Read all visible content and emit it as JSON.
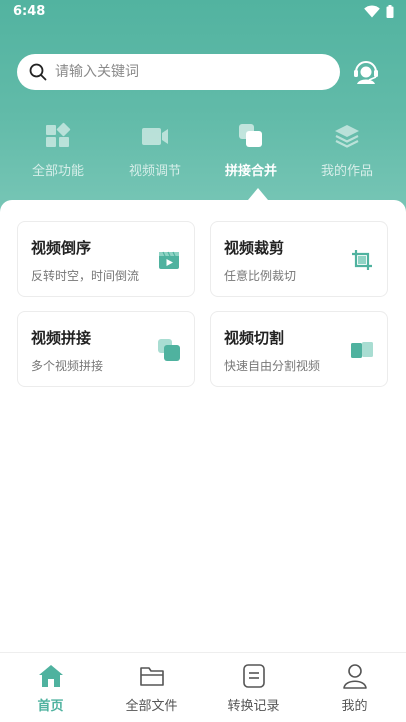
{
  "status_bar": {
    "time": "6:48"
  },
  "search": {
    "placeholder": "请输入关键词"
  },
  "categories": [
    {
      "label": "全部功能",
      "icon": "grid-icon",
      "active": false
    },
    {
      "label": "视频调节",
      "icon": "video-camera-icon",
      "active": false
    },
    {
      "label": "拼接合并",
      "icon": "merge-icon",
      "active": true
    },
    {
      "label": "我的作品",
      "icon": "layers-icon",
      "active": false
    }
  ],
  "tools": [
    {
      "title": "视频倒序",
      "desc": "反转时空，时间倒流",
      "icon": "video-reverse-icon"
    },
    {
      "title": "视频裁剪",
      "desc": "任意比例裁切",
      "icon": "crop-icon"
    },
    {
      "title": "视频拼接",
      "desc": "多个视频拼接",
      "icon": "video-merge-icon"
    },
    {
      "title": "视频切割",
      "desc": "快速自由分割视频",
      "icon": "video-split-icon"
    }
  ],
  "bottom_nav": [
    {
      "label": "首页",
      "icon": "home-icon",
      "active": true
    },
    {
      "label": "全部文件",
      "icon": "folder-icon",
      "active": false
    },
    {
      "label": "转换记录",
      "icon": "document-icon",
      "active": false
    },
    {
      "label": "我的",
      "icon": "user-icon",
      "active": false
    }
  ],
  "colors": {
    "accent": "#4fb29f",
    "hero_top": "#52b3a0",
    "hero_bottom": "#78c6b6"
  }
}
